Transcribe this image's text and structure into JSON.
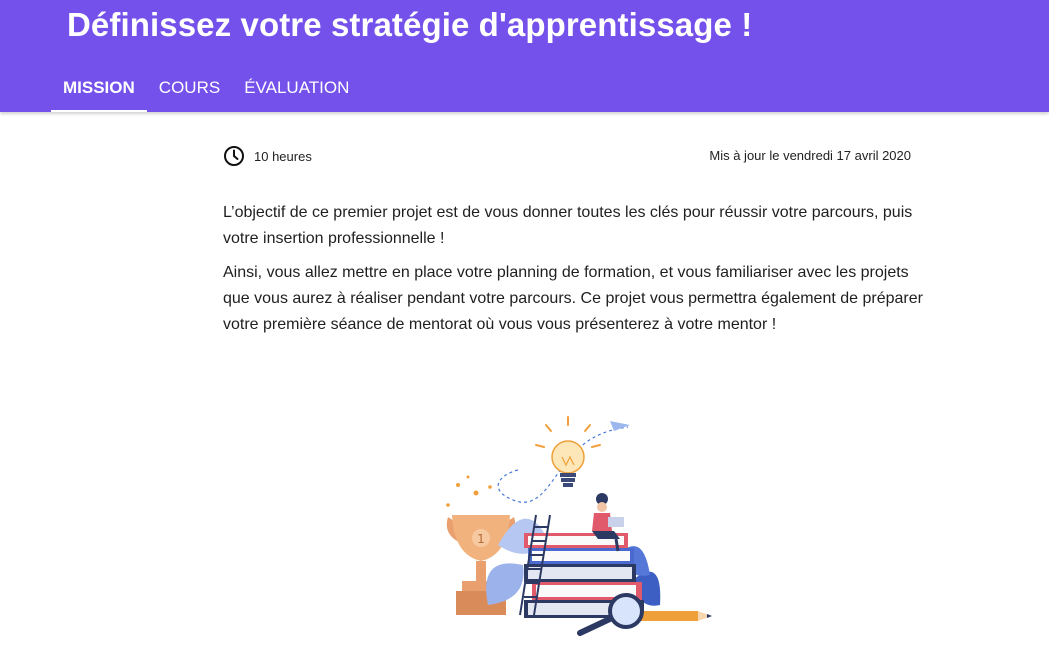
{
  "header": {
    "title": "Définissez votre stratégie d'apprentissage !",
    "tabs": [
      {
        "label": "MISSION",
        "active": true
      },
      {
        "label": "COURS",
        "active": false
      },
      {
        "label": "ÉVALUATION",
        "active": false
      }
    ]
  },
  "meta": {
    "duration_icon": "clock-icon",
    "duration": "10 heures",
    "updated": "Mis à jour le vendredi 17 avril 2020"
  },
  "content": {
    "paragraphs": [
      "L’objectif de ce premier projet est de vous donner toutes les clés pour réussir votre parcours, puis votre insertion professionnelle !",
      "Ainsi, vous allez mettre en place votre planning de formation, et vous familiariser avec les projets que vous aurez à réaliser pendant votre parcours. Ce projet vous permettra également de préparer votre première séance de mentorat où vous vous présenterez à votre mentor !"
    ]
  },
  "colors": {
    "header_bg": "#7451eb",
    "header_text": "#ffffff",
    "body_text": "#1f1f1f"
  },
  "illustration": {
    "icon": "learning-books-illustration"
  }
}
